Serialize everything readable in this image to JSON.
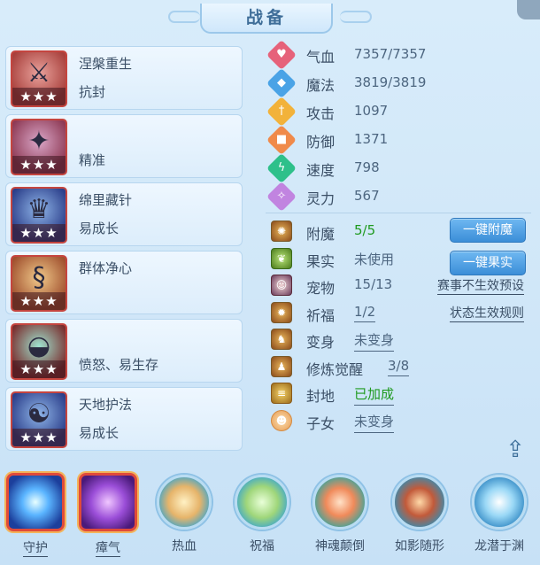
{
  "title": "战备",
  "equipment": [
    {
      "name": "涅槃重生",
      "attr": "抗封",
      "stars": "★★★",
      "icon": "red-weapon-icon"
    },
    {
      "name": "",
      "attr": "精准",
      "stars": "★★★",
      "icon": "green-weapon-icon"
    },
    {
      "name": "绵里藏针",
      "attr": "易成长",
      "stars": "★★★",
      "icon": "warrior-icon"
    },
    {
      "name": "群体净心",
      "attr": "",
      "stars": "★★★",
      "icon": "gold-dragon-icon"
    },
    {
      "name": "",
      "attr": "愤怒、易生存",
      "stars": "★★★",
      "icon": "treasure-bowl-icon"
    },
    {
      "name": "天地护法",
      "attr": "易成长",
      "stars": "★★★",
      "icon": "guardian-icon"
    }
  ],
  "stats": [
    {
      "label": "气血",
      "value": "7357/7357",
      "color": "#e6627a",
      "icon": "heart-icon"
    },
    {
      "label": "魔法",
      "value": "3819/3819",
      "color": "#4aa3e6",
      "icon": "mana-icon"
    },
    {
      "label": "攻击",
      "value": "1097",
      "color": "#f2b23a",
      "icon": "sword-icon"
    },
    {
      "label": "防御",
      "value": "1371",
      "color": "#f08a4a",
      "icon": "shield-icon"
    },
    {
      "label": "速度",
      "value": "798",
      "color": "#2ec08a",
      "icon": "lightning-icon"
    },
    {
      "label": "灵力",
      "value": "567",
      "color": "#c184e0",
      "icon": "spirit-icon"
    }
  ],
  "enhancements": [
    {
      "label": "附魔",
      "value": "5/5",
      "button": "一键附魔"
    },
    {
      "label": "果实",
      "value": "未使用",
      "button": "一键果实"
    },
    {
      "label": "宠物",
      "value": "15/13",
      "link": "赛事不生效预设"
    },
    {
      "label": "祈福",
      "value": "1/2",
      "link": "状态生效规则"
    },
    {
      "label": "变身",
      "value": "未变身"
    },
    {
      "label": "修炼觉醒",
      "value": "3/8"
    },
    {
      "label": "封地",
      "value": "已加成"
    },
    {
      "label": "子女",
      "value": "未变身"
    }
  ],
  "skills": [
    {
      "name": "守护",
      "icon": "guard-icon"
    },
    {
      "name": "瘴气",
      "icon": "miasma-icon"
    },
    {
      "name": "热血",
      "icon": "hot-blood-icon"
    },
    {
      "name": "祝福",
      "icon": "blessing-icon"
    },
    {
      "name": "神魂颠倒",
      "icon": "soul-flip-icon"
    },
    {
      "name": "如影随形",
      "icon": "shadow-follow-icon"
    },
    {
      "name": "龙潜于渊",
      "icon": "dragon-abyss-icon"
    }
  ]
}
